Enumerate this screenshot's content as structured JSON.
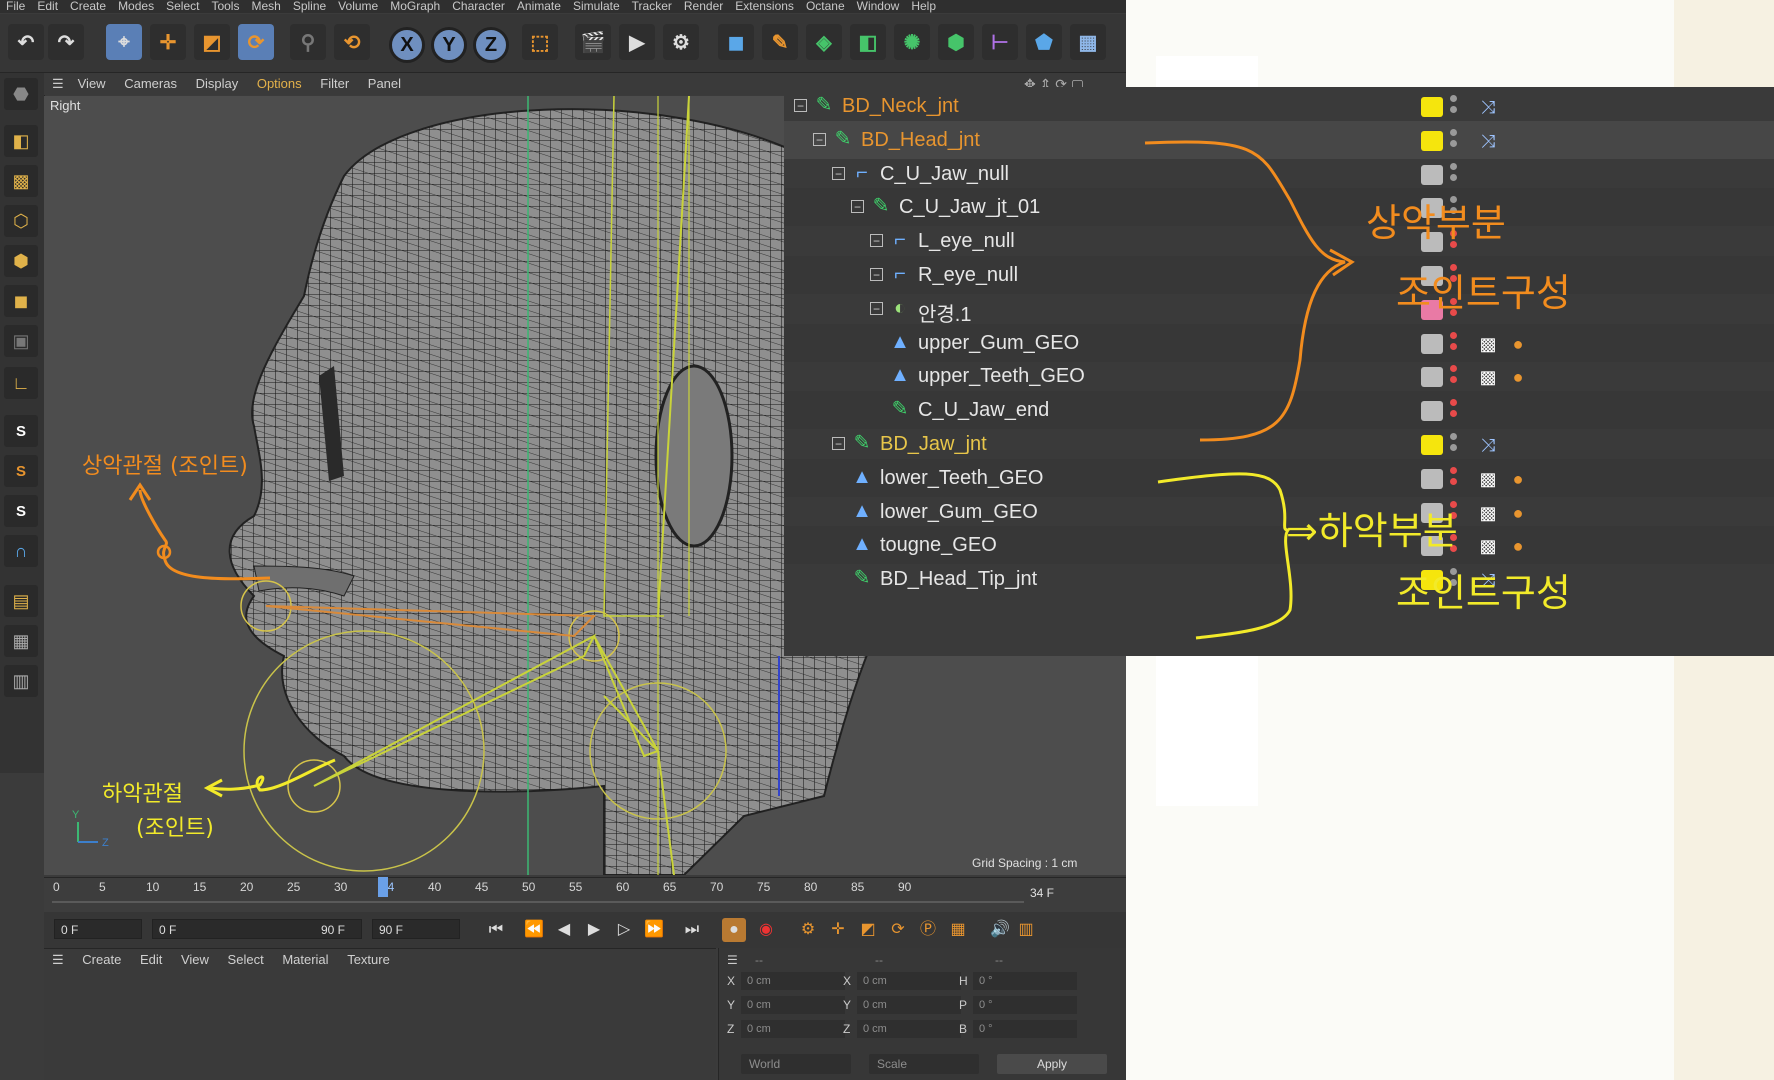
{
  "menubar": [
    "File",
    "Edit",
    "Create",
    "Modes",
    "Select",
    "Tools",
    "Mesh",
    "Spline",
    "Volume",
    "MoGraph",
    "Character",
    "Animate",
    "Simulate",
    "Tracker",
    "Render",
    "Extensions",
    "Octane",
    "Window",
    "Help"
  ],
  "toolbar": {
    "axis_x": "X",
    "axis_y": "Y",
    "axis_z": "Z"
  },
  "viewport": {
    "menu": [
      "View",
      "Cameras",
      "Display",
      "Options",
      "Filter",
      "Panel"
    ],
    "selected_menu": "Options",
    "label": "Right",
    "grid_spacing": "Grid Spacing : 1 cm",
    "axis_y": "Y",
    "axis_z": "Z"
  },
  "timeline": {
    "ticks": [
      "0",
      "5",
      "10",
      "15",
      "20",
      "25",
      "30",
      "34",
      "40",
      "45",
      "50",
      "55",
      "60",
      "65",
      "70",
      "75",
      "80",
      "85",
      "90"
    ],
    "current_frame": 34,
    "current_label": "34 F",
    "start_field": "0 F",
    "range_start": "0 F",
    "range_end": "90 F",
    "end_field": "90 F"
  },
  "material_manager": {
    "menu": [
      "Create",
      "Edit",
      "View",
      "Select",
      "Material",
      "Texture"
    ]
  },
  "coordinates": {
    "header": [
      "--",
      "--",
      "--"
    ],
    "rows": [
      {
        "a": "X",
        "av": "0 cm",
        "b": "X",
        "bv": "0 cm",
        "c": "H",
        "cv": "0 °"
      },
      {
        "a": "Y",
        "av": "0 cm",
        "b": "Y",
        "bv": "0 cm",
        "c": "P",
        "cv": "0 °"
      },
      {
        "a": "Z",
        "av": "0 cm",
        "b": "Z",
        "bv": "0 cm",
        "c": "B",
        "cv": "0 °"
      }
    ],
    "mode_world": "World",
    "mode_scale": "Scale",
    "apply": "Apply"
  },
  "objects": [
    {
      "name": "BD_Neck_jnt",
      "color": "orange",
      "icon": "joint-icon",
      "swatch": "#f5e50d",
      "tag": "ik-tag-icon"
    },
    {
      "name": "BD_Head_jnt",
      "color": "orange",
      "icon": "joint-icon",
      "swatch": "#f5e50d",
      "tag": "ik-tag-icon"
    },
    {
      "name": "C_U_Jaw_null",
      "color": "white",
      "icon": "null-icon",
      "swatch": "#bbbbbb",
      "tag": ""
    },
    {
      "name": "C_U_Jaw_jt_01",
      "color": "white",
      "icon": "joint-icon",
      "swatch": "#bbbbbb",
      "tag": ""
    },
    {
      "name": "L_eye_null",
      "color": "white",
      "icon": "null-icon",
      "swatch": "#bbbbbb",
      "tag": ""
    },
    {
      "name": "R_eye_null",
      "color": "white",
      "icon": "null-icon",
      "swatch": "#bbbbbb",
      "tag": ""
    },
    {
      "name": "안경.1",
      "color": "white",
      "icon": "sphere-icon",
      "swatch": "#e97aa5",
      "tag": ""
    },
    {
      "name": "upper_Gum_GEO",
      "color": "white",
      "icon": "polygon-icon",
      "swatch": "#bbbbbb",
      "tag": "material-tag-icon"
    },
    {
      "name": "upper_Teeth_GEO",
      "color": "white",
      "icon": "polygon-icon",
      "swatch": "#bbbbbb",
      "tag": "material-tag-icon"
    },
    {
      "name": "C_U_Jaw_end",
      "color": "white",
      "icon": "joint-icon",
      "swatch": "#bbbbbb",
      "tag": ""
    },
    {
      "name": "BD_Jaw_jnt",
      "color": "yellow",
      "icon": "joint-icon",
      "swatch": "#f5e50d",
      "tag": "ik-tag-icon"
    },
    {
      "name": "lower_Teeth_GEO",
      "color": "white",
      "icon": "polygon-icon",
      "swatch": "#bbbbbb",
      "tag": "material-tag-icon"
    },
    {
      "name": "lower_Gum_GEO",
      "color": "white",
      "icon": "polygon-icon",
      "swatch": "#bbbbbb",
      "tag": "material-tag-icon"
    },
    {
      "name": "tougne_GEO",
      "color": "white",
      "icon": "polygon-icon",
      "swatch": "#bbbbbb",
      "tag": "material-tag-icon"
    },
    {
      "name": "BD_Head_Tip_jnt",
      "color": "white",
      "icon": "joint-icon",
      "swatch": "#f5e50d",
      "tag": "ik-tag-icon"
    }
  ],
  "annotations": {
    "upper_part_line1": "상악부분",
    "upper_part_line2": "조인트구성",
    "lower_part_line1": "⇒하악부분",
    "lower_part_line2": "조인트구성",
    "upper_joint": "상악관절 (조인트)",
    "lower_joint_line1": "하악관절",
    "lower_joint_line2": "(조인트)"
  },
  "colors": {
    "accent_orange": "#f28c1e",
    "accent_yellow": "#f2ea2a",
    "c4d_bg": "#3b3b3b"
  }
}
